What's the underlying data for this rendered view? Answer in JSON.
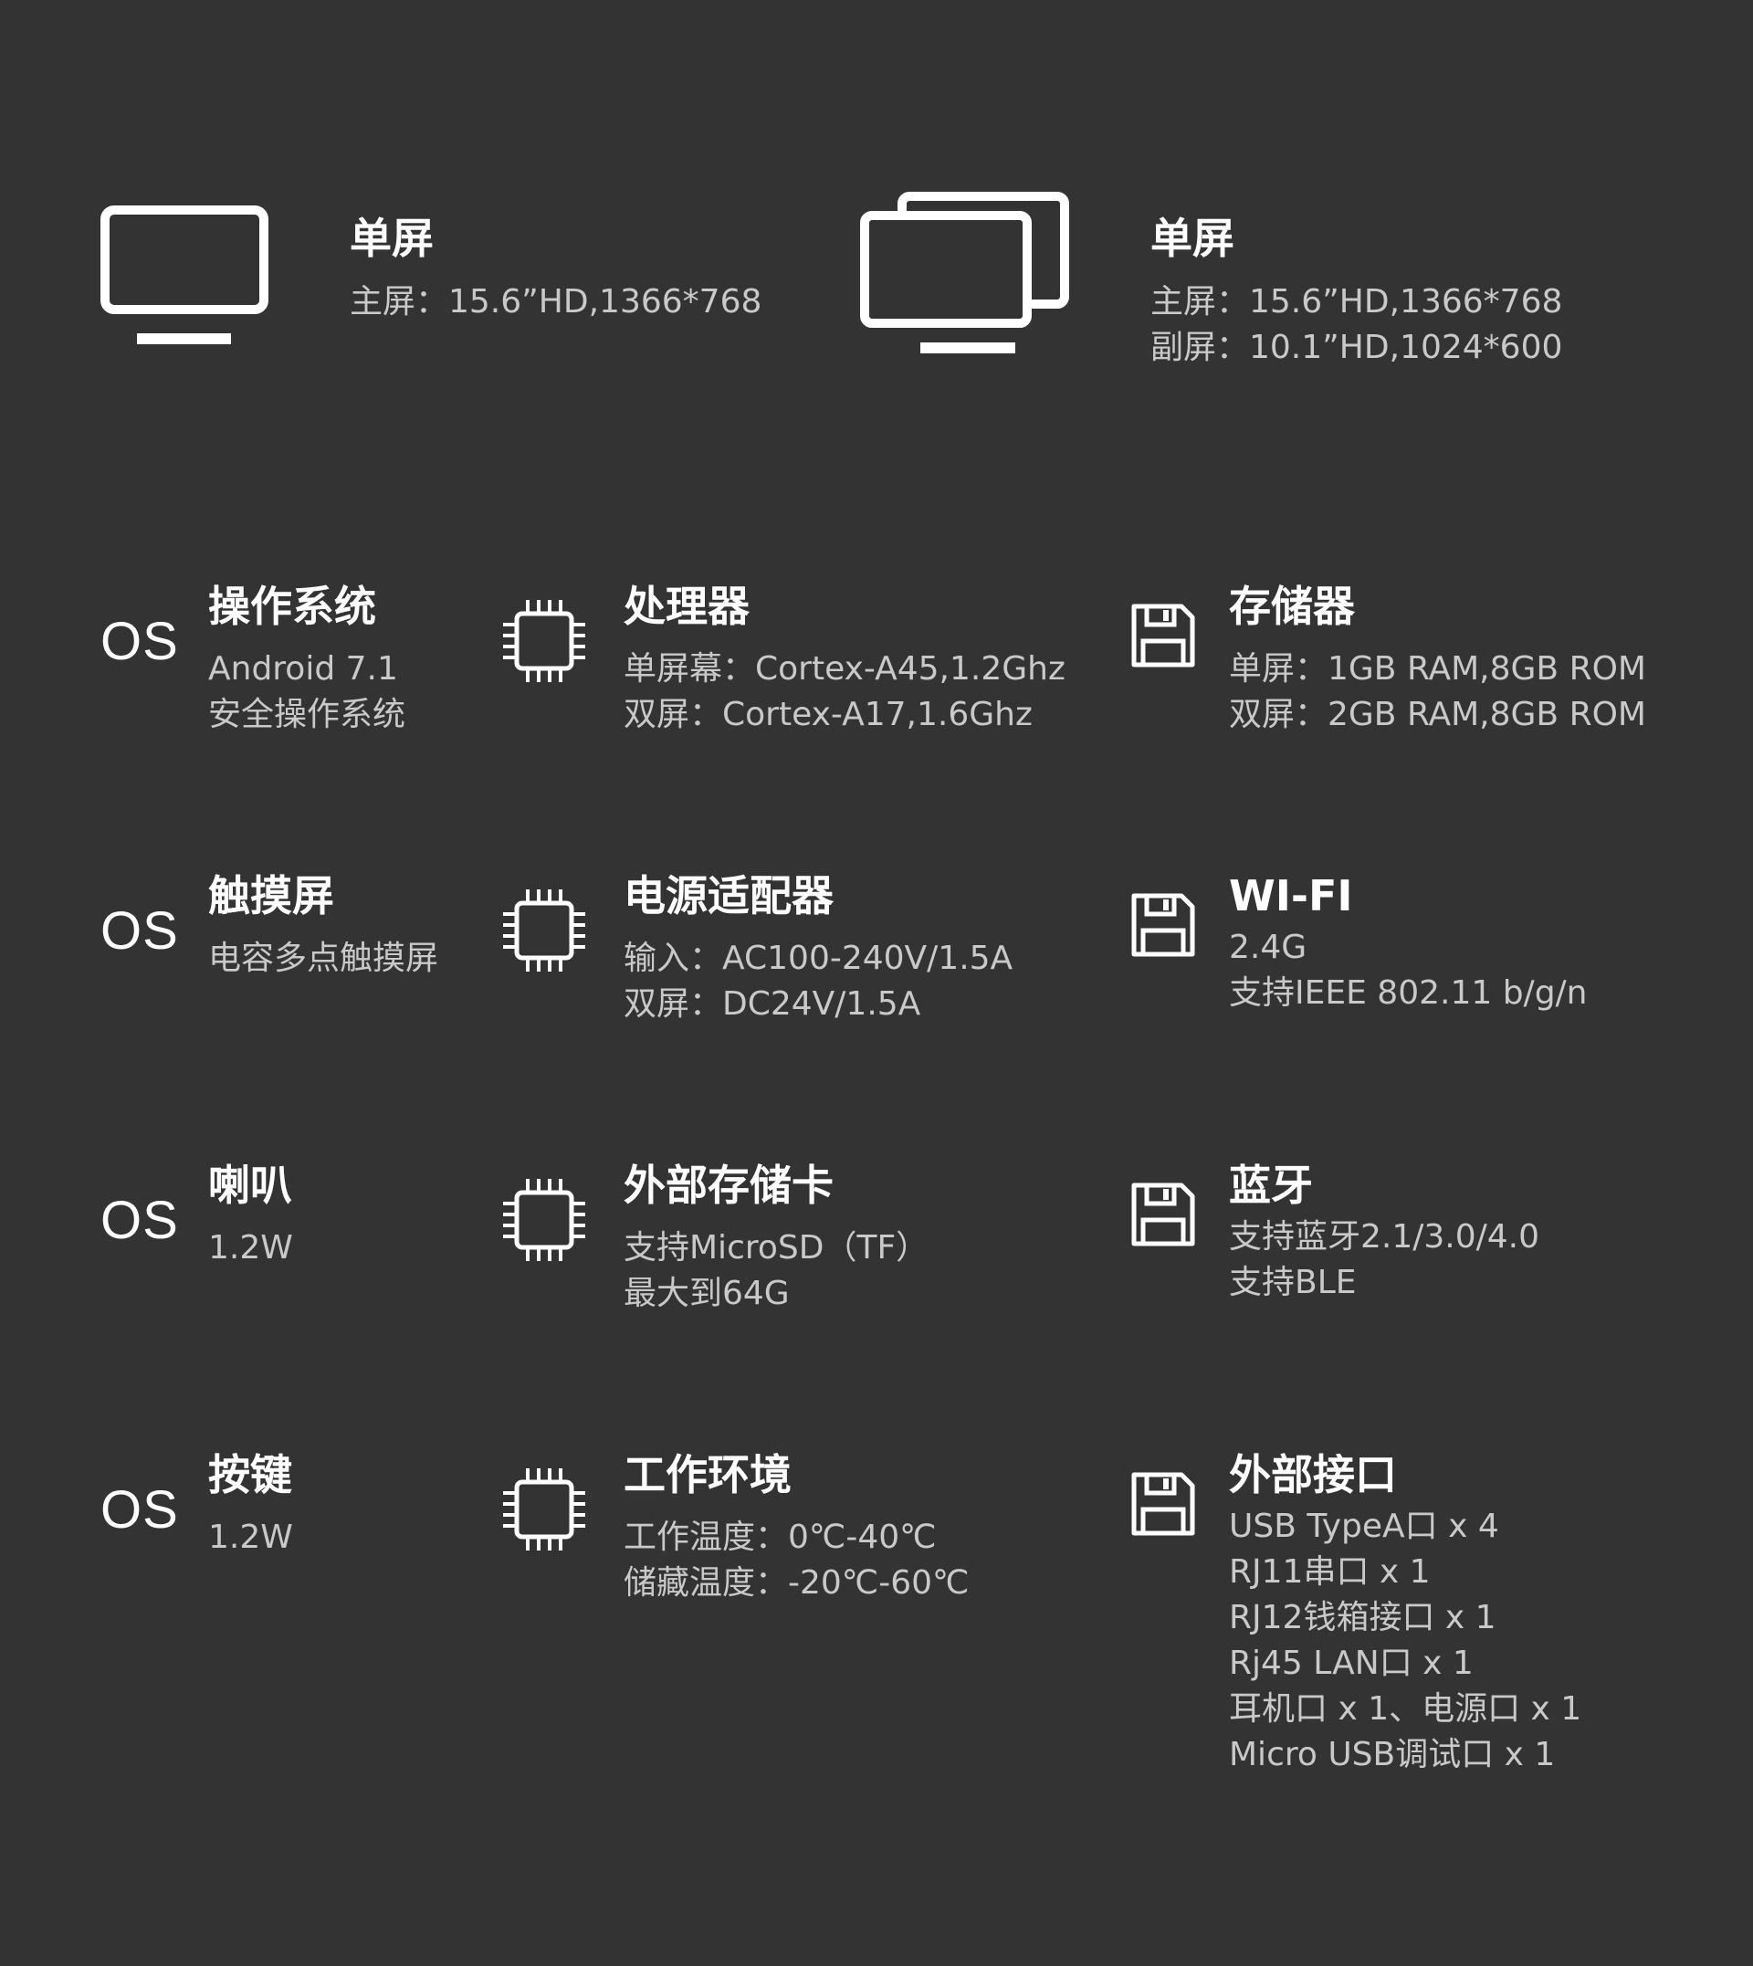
{
  "screens": [
    {
      "icon": "monitor-icon",
      "title": "单屏",
      "lines": [
        "主屏：15.6”HD,1366*768"
      ]
    },
    {
      "icon": "dual-monitor-icon",
      "title": "单屏",
      "lines": [
        "主屏：15.6”HD,1366*768",
        "副屏：10.1”HD,1024*600"
      ]
    }
  ],
  "specs": {
    "col1": [
      {
        "icon_text": "OS",
        "title": "操作系统",
        "lines": [
          "Android 7.1",
          "安全操作系统"
        ]
      },
      {
        "icon_text": "OS",
        "title": "触摸屏",
        "lines": [
          "电容多点触摸屏"
        ]
      },
      {
        "icon_text": "OS",
        "title": "喇叭",
        "lines": [
          "1.2W"
        ]
      },
      {
        "icon_text": "OS",
        "title": "按键",
        "lines": [
          "1.2W"
        ]
      }
    ],
    "col2": [
      {
        "icon": "chip-icon",
        "title": "处理器",
        "lines": [
          "单屏幕：Cortex-A45,1.2Ghz",
          "双屏：Cortex-A17,1.6Ghz"
        ]
      },
      {
        "icon": "chip-icon",
        "title": "电源适配器",
        "lines": [
          "输入：AC100-240V/1.5A",
          "双屏：DC24V/1.5A"
        ]
      },
      {
        "icon": "chip-icon",
        "title": "外部存储卡",
        "lines": [
          "支持MicroSD（TF）",
          "最大到64G"
        ]
      },
      {
        "icon": "chip-icon",
        "title": "工作环境",
        "lines": [
          "工作温度：0℃-40℃",
          "储藏温度：-20℃-60℃"
        ]
      }
    ],
    "col3": [
      {
        "icon": "floppy-disk-icon",
        "title": "存储器",
        "lines": [
          "单屏：1GB RAM,8GB ROM",
          "双屏：2GB RAM,8GB ROM"
        ]
      },
      {
        "icon": "floppy-disk-icon",
        "title": "WI-FI",
        "lines": [
          "2.4G",
          "支持IEEE 802.11 b/g/n"
        ]
      },
      {
        "icon": "floppy-disk-icon",
        "title": "蓝牙",
        "lines": [
          "支持蓝牙2.1/3.0/4.0",
          "支持BLE"
        ]
      },
      {
        "icon": "floppy-disk-icon",
        "title": "外部接口",
        "lines": [
          "USB TypeA口 x 4",
          "RJ11串口 x 1",
          "RJ12钱箱接口 x 1",
          "Rj45 LAN口 x 1",
          "耳机口 x 1、电源口 x 1",
          "Micro USB调试口 x 1"
        ]
      }
    ]
  }
}
